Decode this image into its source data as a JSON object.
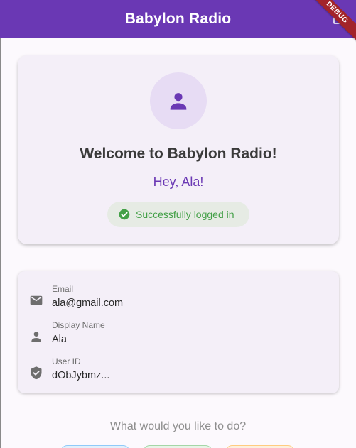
{
  "app_bar": {
    "title": "Babylon Radio",
    "debug_banner": "DEBUG",
    "color": "#6a38b4"
  },
  "welcome_card": {
    "avatar_icon": "person-icon",
    "title": "Welcome to Babylon Radio!",
    "greeting": "Hey, Ala!",
    "status": {
      "icon": "check-circle-icon",
      "text": "Successfully logged in",
      "color": "#43a047"
    }
  },
  "profile": {
    "items": [
      {
        "icon": "email-icon",
        "label": "Email",
        "value": "ala@gmail.com"
      },
      {
        "icon": "person-icon",
        "label": "Display Name",
        "value": "Ala"
      },
      {
        "icon": "verified-user-icon",
        "label": "User ID",
        "value": "dObJybmz..."
      }
    ]
  },
  "actions": {
    "prompt": "What would you like to do?",
    "buttons": [
      {
        "name": "action-button-1",
        "color": "#90caf9"
      },
      {
        "name": "action-button-2",
        "color": "#a5d6a7"
      },
      {
        "name": "action-button-3",
        "color": "#ffcc80"
      }
    ]
  }
}
